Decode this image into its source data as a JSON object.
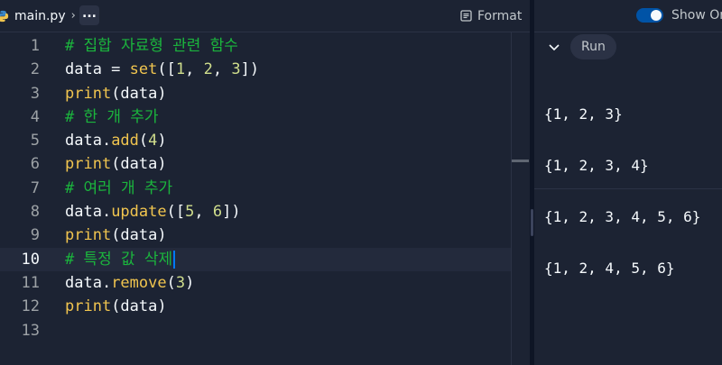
{
  "editor": {
    "filename": "main.py",
    "more_label": "...",
    "format_label": "Format",
    "active_line": 10,
    "lines": [
      {
        "n": "1",
        "tokens": [
          {
            "t": "# 집합 자료형 관련 함수",
            "c": "cm"
          }
        ]
      },
      {
        "n": "2",
        "tokens": [
          {
            "t": "data = ",
            "c": "df"
          },
          {
            "t": "set",
            "c": "fn"
          },
          {
            "t": "([",
            "c": "df"
          },
          {
            "t": "1",
            "c": "nm"
          },
          {
            "t": ", ",
            "c": "df"
          },
          {
            "t": "2",
            "c": "nm"
          },
          {
            "t": ", ",
            "c": "df"
          },
          {
            "t": "3",
            "c": "nm"
          },
          {
            "t": "])",
            "c": "df"
          }
        ]
      },
      {
        "n": "3",
        "tokens": [
          {
            "t": "print",
            "c": "fn"
          },
          {
            "t": "(data)",
            "c": "df"
          }
        ]
      },
      {
        "n": "4",
        "tokens": [
          {
            "t": "# 한 개 추가",
            "c": "cm"
          }
        ]
      },
      {
        "n": "5",
        "tokens": [
          {
            "t": "data.",
            "c": "df"
          },
          {
            "t": "add",
            "c": "fn"
          },
          {
            "t": "(",
            "c": "df"
          },
          {
            "t": "4",
            "c": "nm"
          },
          {
            "t": ")",
            "c": "df"
          }
        ]
      },
      {
        "n": "6",
        "tokens": [
          {
            "t": "print",
            "c": "fn"
          },
          {
            "t": "(data)",
            "c": "df"
          }
        ]
      },
      {
        "n": "7",
        "tokens": [
          {
            "t": "# 여러 개 추가",
            "c": "cm"
          }
        ]
      },
      {
        "n": "8",
        "tokens": [
          {
            "t": "data.",
            "c": "df"
          },
          {
            "t": "update",
            "c": "fn"
          },
          {
            "t": "([",
            "c": "df"
          },
          {
            "t": "5",
            "c": "nm"
          },
          {
            "t": ", ",
            "c": "df"
          },
          {
            "t": "6",
            "c": "nm"
          },
          {
            "t": "])",
            "c": "df"
          }
        ]
      },
      {
        "n": "9",
        "tokens": [
          {
            "t": "print",
            "c": "fn"
          },
          {
            "t": "(data)",
            "c": "df"
          }
        ]
      },
      {
        "n": "10",
        "tokens": [
          {
            "t": "# 특정 값 삭제",
            "c": "cm"
          }
        ]
      },
      {
        "n": "11",
        "tokens": [
          {
            "t": "data.",
            "c": "df"
          },
          {
            "t": "remove",
            "c": "fn"
          },
          {
            "t": "(",
            "c": "df"
          },
          {
            "t": "3",
            "c": "nm"
          },
          {
            "t": ")",
            "c": "df"
          }
        ]
      },
      {
        "n": "12",
        "tokens": [
          {
            "t": "print",
            "c": "fn"
          },
          {
            "t": "(data)",
            "c": "df"
          }
        ]
      },
      {
        "n": "13",
        "tokens": []
      }
    ]
  },
  "console": {
    "show_only_label": "Show Or",
    "run_label": "Run",
    "output": [
      "{1, 2, 3}",
      "{1, 2, 3, 4}",
      "{1, 2, 3, 4, 5, 6}",
      "{1, 2, 4, 5, 6}"
    ]
  },
  "icons": {
    "file": "python-file-icon",
    "breadcrumb": "chevron-right-icon",
    "format": "format-icon",
    "collapse": "chevron-down-icon"
  },
  "colors": {
    "background": "#1c2333",
    "comment": "#1bb53d",
    "function": "#f1c54f",
    "number": "#cfdd8c",
    "cursor": "#0079f2",
    "toggle": "#0053a6"
  }
}
